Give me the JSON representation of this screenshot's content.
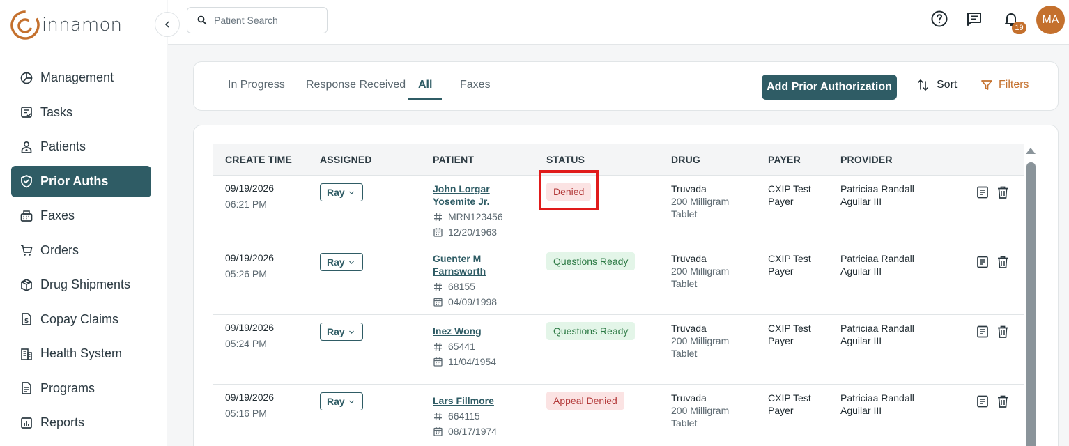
{
  "brand": {
    "logo_text": "innamon",
    "accent": "#c4702d",
    "primary": "#2f5c65"
  },
  "sidebar": {
    "items": [
      {
        "label": "Management",
        "icon": "pie-chart-icon"
      },
      {
        "label": "Tasks",
        "icon": "checklist-icon"
      },
      {
        "label": "Patients",
        "icon": "patient-icon"
      },
      {
        "label": "Prior Auths",
        "icon": "shield-check-icon",
        "active": true
      },
      {
        "label": "Faxes",
        "icon": "fax-icon"
      },
      {
        "label": "Orders",
        "icon": "cart-icon"
      },
      {
        "label": "Drug Shipments",
        "icon": "package-icon"
      },
      {
        "label": "Copay Claims",
        "icon": "dollar-document-icon"
      },
      {
        "label": "Health System",
        "icon": "building-icon"
      },
      {
        "label": "Programs",
        "icon": "document-icon"
      },
      {
        "label": "Reports",
        "icon": "bar-chart-icon"
      }
    ]
  },
  "topbar": {
    "search_placeholder": "Patient Search",
    "notification_count": "19",
    "avatar_initials": "MA"
  },
  "tabs": {
    "items": [
      "In Progress",
      "Response Received",
      "All",
      "Faxes"
    ],
    "active": "All",
    "add_button": "Add Prior Authorization",
    "sort_label": "Sort",
    "filters_label": "Filters"
  },
  "table": {
    "headers": [
      "CREATE TIME",
      "ASSIGNED",
      "PATIENT",
      "STATUS",
      "DRUG",
      "PAYER",
      "PROVIDER"
    ],
    "rows": [
      {
        "date": "09/19/2026",
        "time": "06:21 PM",
        "assigned": "Ray",
        "patient_line1": "John Lorgar",
        "patient_line2": "Yosemite Jr.",
        "mrn": "MRN123456",
        "dob": "12/20/1963",
        "status": "Denied",
        "status_type": "denied",
        "drug": "Truvada",
        "drug_detail1": "200 Milligram",
        "drug_detail2": "Tablet",
        "payer1": "CXIP Test",
        "payer2": "Payer",
        "provider1": "Patriciaa Randall",
        "provider2": "Aguilar III"
      },
      {
        "date": "09/19/2026",
        "time": "05:26 PM",
        "assigned": "Ray",
        "patient_line1": "Guenter M",
        "patient_line2": "Farnsworth",
        "mrn": "68155",
        "dob": "04/09/1998",
        "status": "Questions Ready",
        "status_type": "ready",
        "drug": "Truvada",
        "drug_detail1": "200 Milligram",
        "drug_detail2": "Tablet",
        "payer1": "CXIP Test",
        "payer2": "Payer",
        "provider1": "Patriciaa Randall",
        "provider2": "Aguilar III"
      },
      {
        "date": "09/19/2026",
        "time": "05:24 PM",
        "assigned": "Ray",
        "patient_line1": "Inez Wong",
        "patient_line2": "",
        "mrn": "65441",
        "dob": "11/04/1954",
        "status": "Questions Ready",
        "status_type": "ready",
        "drug": "Truvada",
        "drug_detail1": "200 Milligram",
        "drug_detail2": "Tablet",
        "payer1": "CXIP Test",
        "payer2": "Payer",
        "provider1": "Patriciaa Randall",
        "provider2": "Aguilar III"
      },
      {
        "date": "09/19/2026",
        "time": "05:16 PM",
        "assigned": "Ray",
        "patient_line1": "Lars Fillmore",
        "patient_line2": "",
        "mrn": "664115",
        "dob": "08/17/1974",
        "status": "Appeal Denied",
        "status_type": "denied",
        "drug": "Truvada",
        "drug_detail1": "200 Milligram",
        "drug_detail2": "Tablet",
        "payer1": "CXIP Test",
        "payer2": "Payer",
        "provider1": "Patriciaa Randall",
        "provider2": "Aguilar III"
      }
    ]
  }
}
